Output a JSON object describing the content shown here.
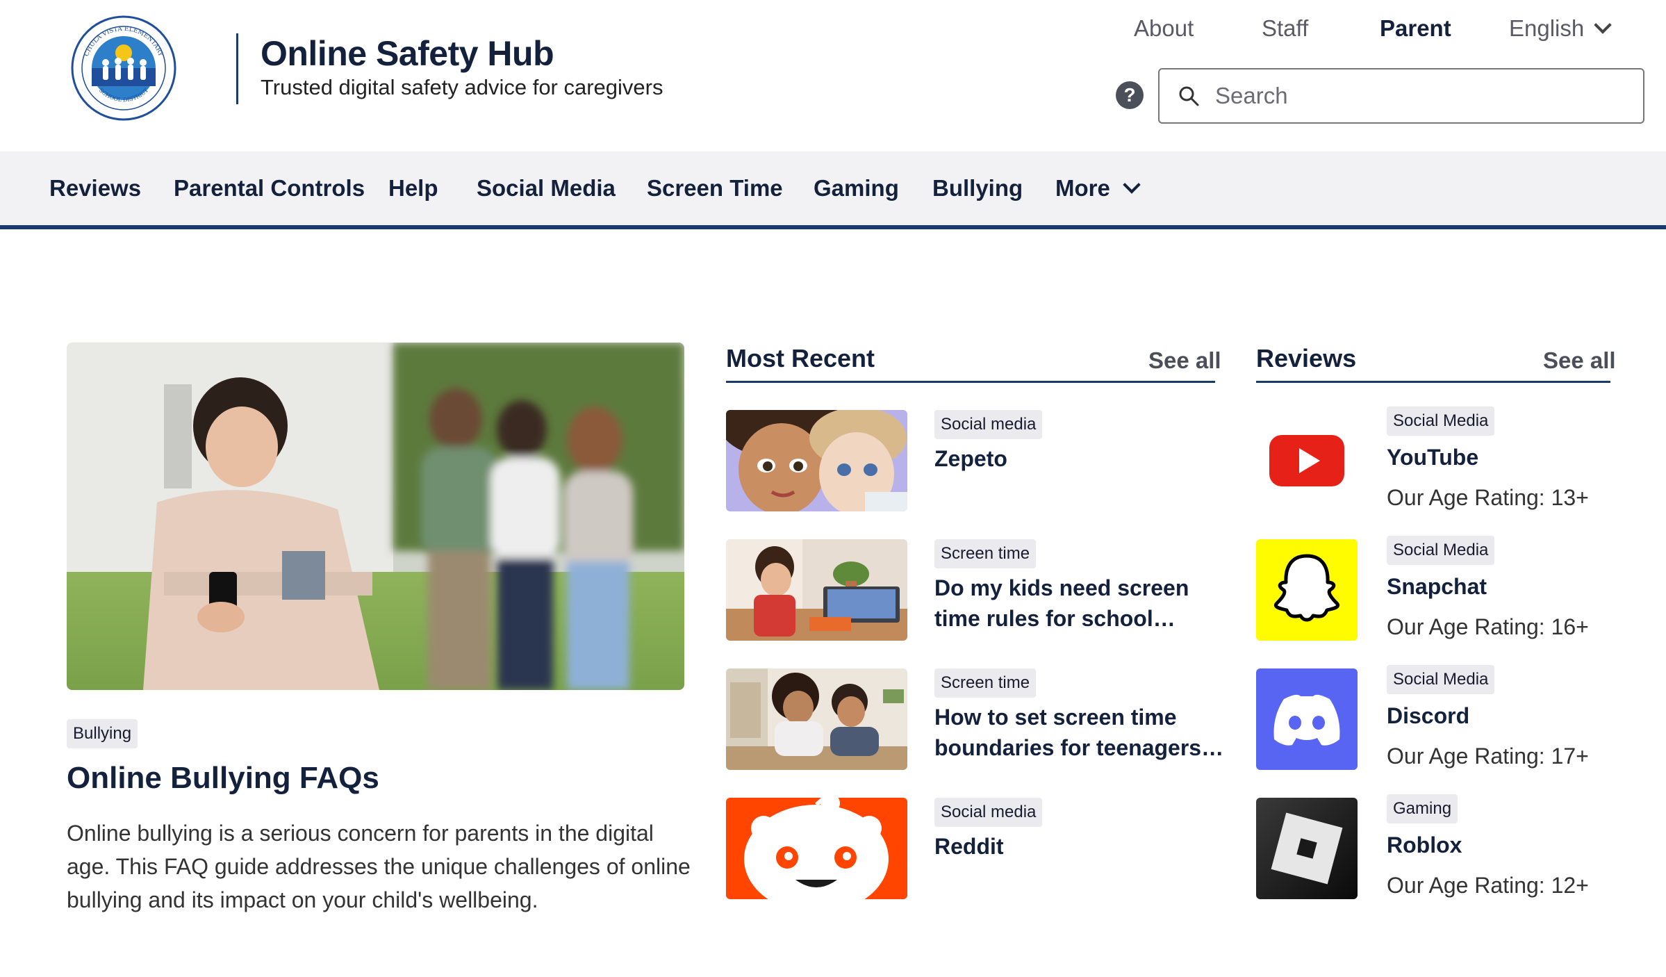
{
  "brand": {
    "title": "Online Safety Hub",
    "subtitle": "Trusted digital safety advice for caregivers",
    "logo_text_top": "CHULA VISTA ELEMENTARY",
    "logo_text_bottom": "SCHOOL DISTRICT"
  },
  "top_nav": {
    "about": "About",
    "staff": "Staff",
    "parent": "Parent",
    "language": "English"
  },
  "help": {
    "label": "?"
  },
  "search": {
    "placeholder": "Search"
  },
  "categories": [
    "Reviews",
    "Parental Controls",
    "Help",
    "Social Media",
    "Screen Time",
    "Gaming",
    "Bullying",
    "More"
  ],
  "featured": {
    "tag": "Bullying",
    "title": "Online Bullying FAQs",
    "description": "Online bullying is a serious concern for parents in the digital age. This FAQ guide addresses the unique challenges of online bullying and its impact on your child's wellbeing."
  },
  "most_recent": {
    "title": "Most Recent",
    "see_all": "See all",
    "items": [
      {
        "tag": "Social media",
        "title": "Zepeto"
      },
      {
        "tag": "Screen time",
        "title": "Do my kids need screen time rules for school…"
      },
      {
        "tag": "Screen time",
        "title": "How to set screen time boundaries for teenagers…"
      },
      {
        "tag": "Social media",
        "title": "Reddit"
      }
    ]
  },
  "reviews": {
    "title": "Reviews",
    "see_all": "See all",
    "items": [
      {
        "tag": "Social Media",
        "name": "YouTube",
        "rating": "Our Age Rating: 13+",
        "icon": "youtube-icon",
        "color": "#e62117"
      },
      {
        "tag": "Social Media",
        "name": "Snapchat",
        "rating": "Our Age Rating: 16+",
        "icon": "snapchat-icon",
        "color": "#fffc00"
      },
      {
        "tag": "Social Media",
        "name": "Discord",
        "rating": "Our Age Rating: 17+",
        "icon": "discord-icon",
        "color": "#5865f2"
      },
      {
        "tag": "Gaming",
        "name": "Roblox",
        "rating": "Our Age Rating: 12+",
        "icon": "roblox-icon",
        "color": "#111111"
      }
    ]
  },
  "colors": {
    "brand_navy": "#14213d",
    "rule_blue": "#1a3a6b",
    "tag_bg": "#ebebef",
    "nav_bg": "#f2f2f4"
  }
}
